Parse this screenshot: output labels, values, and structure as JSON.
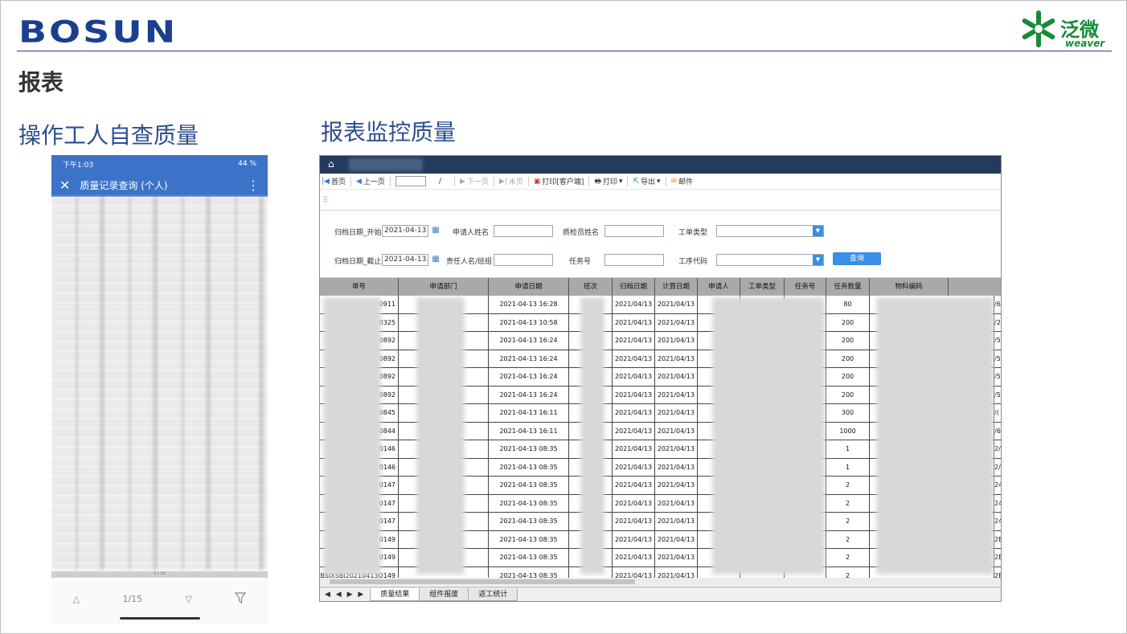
{
  "header": {
    "bosun_logo": "BOSUN",
    "weaver_logo_cn": "泛微",
    "weaver_logo_en": "weaver",
    "page_title": "报表"
  },
  "sections": {
    "left_title": "操作工人自查质量",
    "right_title": "报表监控质量"
  },
  "phone": {
    "status_time": "下午1:03",
    "status_right": "44 %",
    "app_title": "质量记录查询 (个人)",
    "pager_text": "1/15",
    "pager_small": "1 / 15"
  },
  "report": {
    "toolbar": {
      "first": "首页",
      "prev": "上一页",
      "slash": "/",
      "next": "下一页",
      "last": "末页",
      "print_client": "打印[客户端]",
      "print": "打印",
      "export": "导出",
      "mail": "邮件"
    },
    "form": {
      "date_start_label": "归档日期_开始",
      "date_start_value": "2021-04-13",
      "applicant_label": "申请人姓名",
      "inspector_label": "质检员姓名",
      "order_type_label": "工单类型",
      "date_end_label": "归档日期_截止",
      "date_end_value": "2021-04-13",
      "owner_label": "责任人名/班组",
      "task_label": "任务号",
      "process_label": "工序代码",
      "query_button": "查询"
    },
    "columns": [
      "单号",
      "申请部门",
      "申请日期",
      "班次",
      "归档日期",
      "计算日期",
      "申请人",
      "工单类型",
      "任务号",
      "任务数量",
      "物料编码"
    ],
    "rows": [
      {
        "id_tail": "0911",
        "apply_date": "2021-04-13 16:28",
        "archive": "2021/04/13",
        "calc": "2021/04/13",
        "qty": "80",
        "mat_tail": "/6"
      },
      {
        "id_tail": "0325",
        "apply_date": "2021-04-13 10:58",
        "archive": "2021/04/13",
        "calc": "2021/04/13",
        "qty": "200",
        "mat_tail": "/2"
      },
      {
        "id_tail": "0892",
        "apply_date": "2021-04-13 16:24",
        "archive": "2021/04/13",
        "calc": "2021/04/13",
        "qty": "200",
        "mat_tail": "/5"
      },
      {
        "id_tail": "0892",
        "apply_date": "2021-04-13 16:24",
        "archive": "2021/04/13",
        "calc": "2021/04/13",
        "qty": "200",
        "mat_tail": "/5"
      },
      {
        "id_tail": "0892",
        "apply_date": "2021-04-13 16:24",
        "archive": "2021/04/13",
        "calc": "2021/04/13",
        "qty": "200",
        "mat_tail": "/5"
      },
      {
        "id_tail": "0892",
        "apply_date": "2021-04-13 16:24",
        "archive": "2021/04/13",
        "calc": "2021/04/13",
        "qty": "200",
        "mat_tail": "/5"
      },
      {
        "id_tail": "0845",
        "apply_date": "2021-04-13 16:11",
        "archive": "2021/04/13",
        "calc": "2021/04/13",
        "qty": "300",
        "mat_tail": "/("
      },
      {
        "id_tail": "0844",
        "apply_date": "2021-04-13 16:11",
        "archive": "2021/04/13",
        "calc": "2021/04/13",
        "qty": "1000",
        "mat_tail": "/6"
      },
      {
        "id_tail": "0146",
        "apply_date": "2021-04-13 08:35",
        "archive": "2021/04/13",
        "calc": "2021/04/13",
        "qty": "1",
        "mat_tail": "2/"
      },
      {
        "id_tail": "0146",
        "apply_date": "2021-04-13 08:35",
        "archive": "2021/04/13",
        "calc": "2021/04/13",
        "qty": "1",
        "mat_tail": "2/"
      },
      {
        "id_tail": "0147",
        "apply_date": "2021-04-13 08:35",
        "archive": "2021/04/13",
        "calc": "2021/04/13",
        "qty": "2",
        "mat_tail": "24"
      },
      {
        "id_tail": "0147",
        "apply_date": "2021-04-13 08:35",
        "archive": "2021/04/13",
        "calc": "2021/04/13",
        "qty": "2",
        "mat_tail": "24"
      },
      {
        "id_tail": "0147",
        "apply_date": "2021-04-13 08:35",
        "archive": "2021/04/13",
        "calc": "2021/04/13",
        "qty": "2",
        "mat_tail": "24"
      },
      {
        "id_tail": "0149",
        "apply_date": "2021-04-13 08:35",
        "archive": "2021/04/13",
        "calc": "2021/04/13",
        "qty": "2",
        "mat_tail": "2E"
      },
      {
        "id_tail": "0149",
        "apply_date": "2021-04-13 08:35",
        "archive": "2021/04/13",
        "calc": "2021/04/13",
        "qty": "2",
        "mat_tail": "2E"
      },
      {
        "id_tail": "BSJXSBJ20210413O149",
        "apply_date": "2021-04-13 08:35",
        "archive": "2021/04/13",
        "calc": "2021/04/13",
        "qty": "2",
        "mat_tail": "2E"
      }
    ],
    "sheet_tabs": [
      "质量结果",
      "组件报废",
      "返工统计"
    ],
    "sheet_nav": "◀ ◀ ▶ ▶"
  },
  "colors": {
    "brand_blue": "#1b3f8f",
    "weaver_green": "#1a8a3a",
    "phone_bar": "#3b73c8",
    "report_topbar": "#253a5e",
    "query_button": "#3a8ee6"
  }
}
